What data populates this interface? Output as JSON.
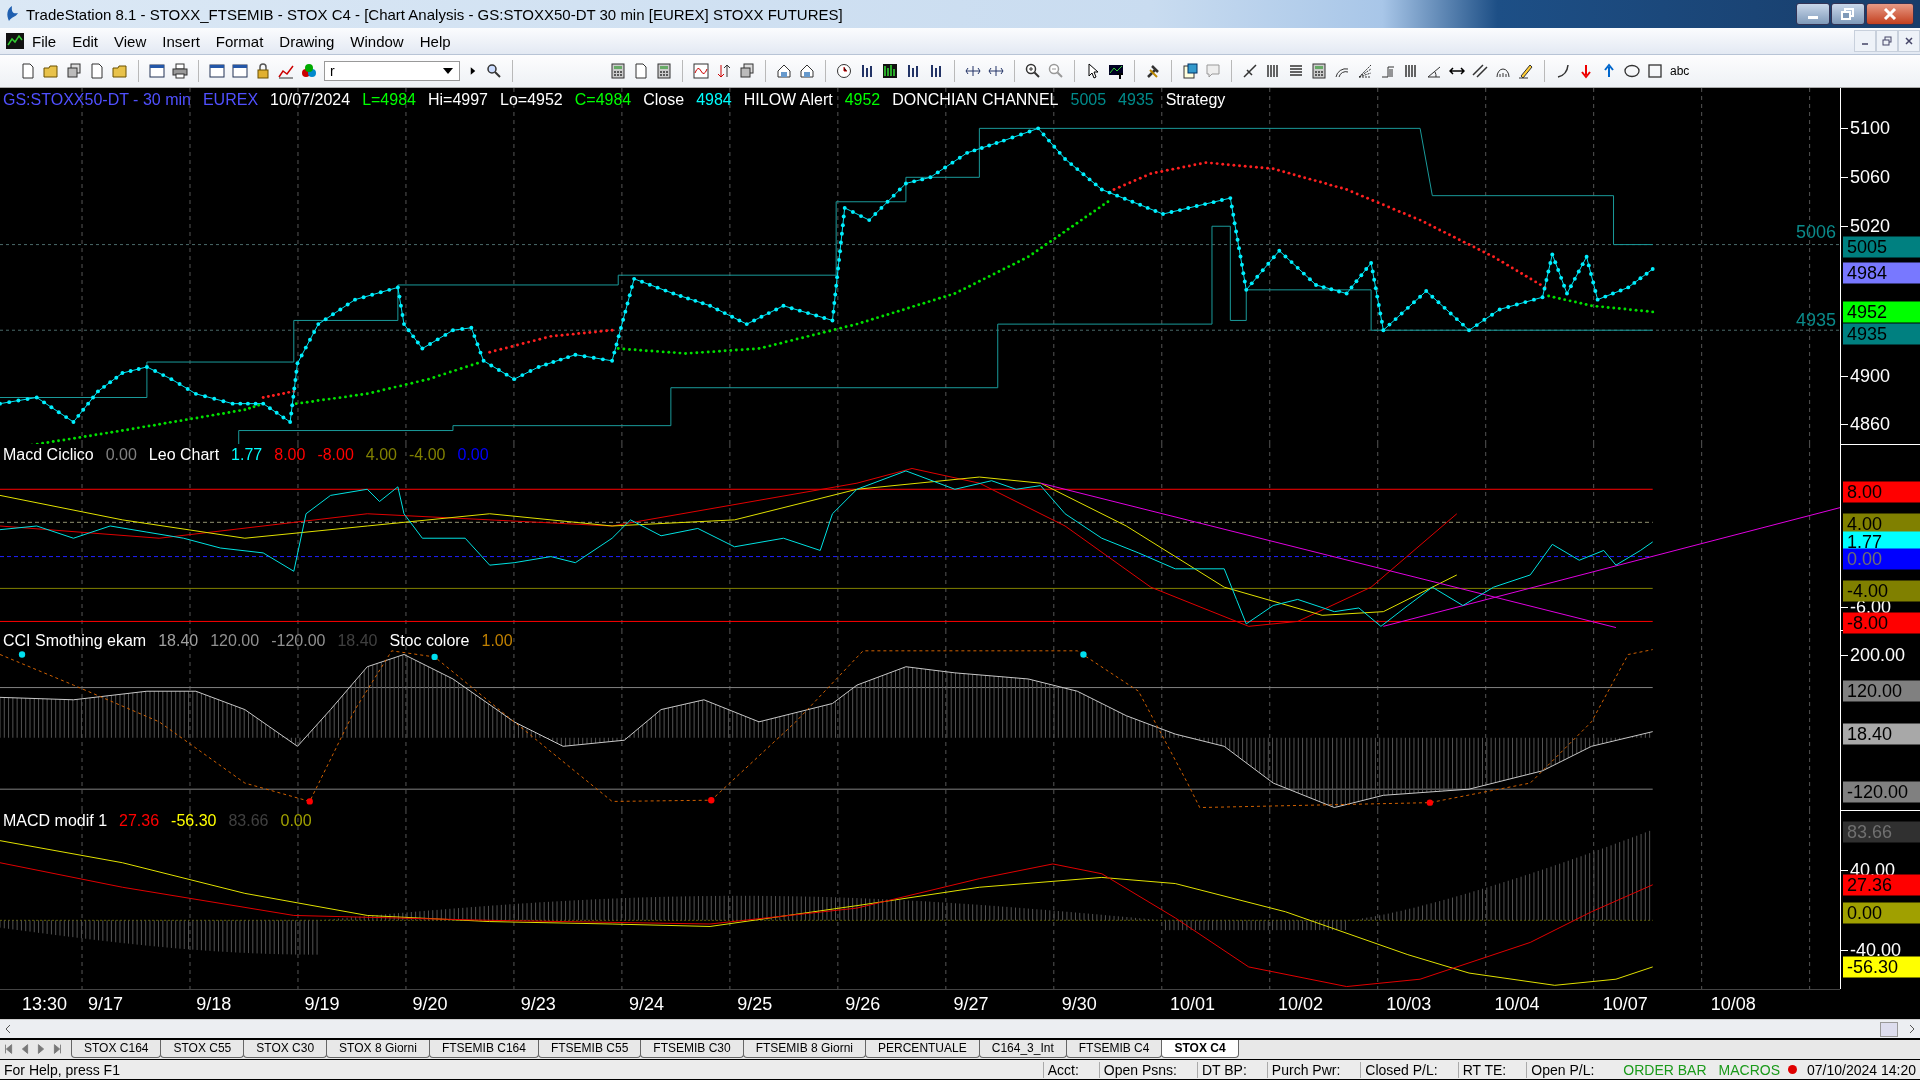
{
  "window": {
    "title": "TradeStation 8.1 - STOXX_FTSEMIB - STOX  C4 - [Chart Analysis - GS:STOXX50-DT  30 min  [EUREX] STOXX FUTURES]"
  },
  "menu": [
    "File",
    "Edit",
    "View",
    "Insert",
    "Format",
    "Drawing",
    "Window",
    "Help"
  ],
  "toolbar": {
    "symbol_field": {
      "value": "r"
    },
    "text_tool": "abc"
  },
  "chart": {
    "panels": [
      {
        "kind": "price",
        "legend": [
          {
            "text": "GS:STOXX50-DT - 30 min",
            "color": "#5050ff"
          },
          {
            "text": "EUREX",
            "color": "#5050ff"
          },
          {
            "text": "10/07/2024",
            "color": "#ffffff"
          },
          {
            "text": "L=4984",
            "color": "#00ff00"
          },
          {
            "text": "Hi=4997",
            "color": "#ffffff"
          },
          {
            "text": "Lo=4952",
            "color": "#ffffff"
          },
          {
            "text": "C=4984",
            "color": "#00ff00"
          },
          {
            "text": "Close",
            "color": "#ffffff"
          },
          {
            "text": "4984",
            "color": "#00ffff"
          },
          {
            "text": "HILOW Alert",
            "color": "#ffffff"
          },
          {
            "text": "4952",
            "color": "#00ff00"
          },
          {
            "text": "DONCHIAN CHANNEL",
            "color": "#ffffff"
          },
          {
            "text": "5005",
            "color": "#008b8b"
          },
          {
            "text": "4935",
            "color": "#008b8b"
          },
          {
            "text": "Strategy",
            "color": "#ffffff"
          }
        ],
        "line_labels": [
          "5006",
          "4935"
        ],
        "axis_labels": [
          "5100",
          "5060",
          "5020",
          "4900",
          "4860"
        ],
        "value_tags": [
          {
            "text": "5005",
            "color": "#008080"
          },
          {
            "text": "4984",
            "color": "#7878ff"
          },
          {
            "text": "4952",
            "color": "#00ff00"
          },
          {
            "text": "4935",
            "color": "#008080"
          }
        ]
      },
      {
        "kind": "oscillator",
        "legend": [
          {
            "text": "Macd Ciclico",
            "color": "#ffffff"
          },
          {
            "text": "0.00",
            "color": "#808080"
          },
          {
            "text": "Leo Chart",
            "color": "#ffffff"
          },
          {
            "text": "1.77",
            "color": "#00ffff"
          },
          {
            "text": "8.00",
            "color": "#ff0000"
          },
          {
            "text": "-8.00",
            "color": "#ff0000"
          },
          {
            "text": "4.00",
            "color": "#808000"
          },
          {
            "text": "-4.00",
            "color": "#808000"
          },
          {
            "text": "0.00",
            "color": "#0000ff"
          }
        ],
        "axis_labels": [
          "-6.00"
        ],
        "value_tags": [
          {
            "text": "8.00",
            "color": "#ff0000"
          },
          {
            "text": "4.00",
            "color": "#808000"
          },
          {
            "text": "1.77",
            "color": "#00ffff"
          },
          {
            "text": "0.00",
            "color": "#0000ff"
          },
          {
            "text": "-4.00",
            "color": "#808000"
          },
          {
            "text": "-8.00",
            "color": "#ff0000"
          }
        ]
      },
      {
        "kind": "cci",
        "legend": [
          {
            "text": "CCI Smothing ekam",
            "color": "#ffffff"
          },
          {
            "text": "18.40",
            "color": "#a0a0a0"
          },
          {
            "text": "120.00",
            "color": "#909090"
          },
          {
            "text": "-120.00",
            "color": "#909090"
          },
          {
            "text": "18.40",
            "color": "#404040"
          },
          {
            "text": "Stoc colore",
            "color": "#ffffff"
          },
          {
            "text": "1.00",
            "color": "#c08000"
          }
        ],
        "axis_labels": [
          "200.00"
        ],
        "value_tags": [
          {
            "text": "120.00",
            "color": "#808080"
          },
          {
            "text": "18.40",
            "color": "#a8a8a8"
          },
          {
            "text": "-120.00",
            "color": "#808080"
          }
        ]
      },
      {
        "kind": "macd",
        "legend": [
          {
            "text": "MACD modif 1",
            "color": "#ffffff"
          },
          {
            "text": "27.36",
            "color": "#ff0000"
          },
          {
            "text": "-56.30",
            "color": "#ffff00"
          },
          {
            "text": "83.66",
            "color": "#404040"
          },
          {
            "text": "0.00",
            "color": "#a0a000"
          }
        ],
        "axis_labels": [
          "40.00",
          "-40.00"
        ],
        "value_tags": [
          {
            "text": "83.66",
            "color": "#303030"
          },
          {
            "text": "27.36",
            "color": "#ff0000"
          },
          {
            "text": "0.00",
            "color": "#a0a000"
          },
          {
            "text": "-56.30",
            "color": "#ffff00"
          }
        ]
      }
    ],
    "time_axis": [
      "13:30",
      "9/17",
      "9/18",
      "9/19",
      "9/20",
      "9/23",
      "9/24",
      "9/25",
      "9/26",
      "9/27",
      "9/30",
      "10/01",
      "10/02",
      "10/03",
      "10/04",
      "10/07",
      "10/08"
    ]
  },
  "sheet_tabs": [
    {
      "label": "STOX C164",
      "selected": false
    },
    {
      "label": "STOX C55",
      "selected": false
    },
    {
      "label": "STOX  C30",
      "selected": false
    },
    {
      "label": "STOX  8 Giorni",
      "selected": false
    },
    {
      "label": "FTSEMIB C164",
      "selected": false
    },
    {
      "label": "FTSEMIB C55",
      "selected": false
    },
    {
      "label": "FTSEMIB C30",
      "selected": false
    },
    {
      "label": "FTSEMIB  8 Giorni",
      "selected": false
    },
    {
      "label": "PERCENTUALE",
      "selected": false
    },
    {
      "label": "C164_3_Int",
      "selected": false
    },
    {
      "label": "FTSEMIB C4",
      "selected": false
    },
    {
      "label": "STOX  C4",
      "selected": true
    }
  ],
  "status_bar": {
    "help": "For Help, press F1",
    "fields": [
      "Acct:",
      "Open Psns:",
      "DT BP:",
      "Purch Pwr:",
      "Closed P/L:",
      "RT TE:",
      "Open P/L:"
    ],
    "indicators": [
      "ORDER BAR",
      "MACROS"
    ],
    "datetime": "07/10/2024 14:20"
  }
}
